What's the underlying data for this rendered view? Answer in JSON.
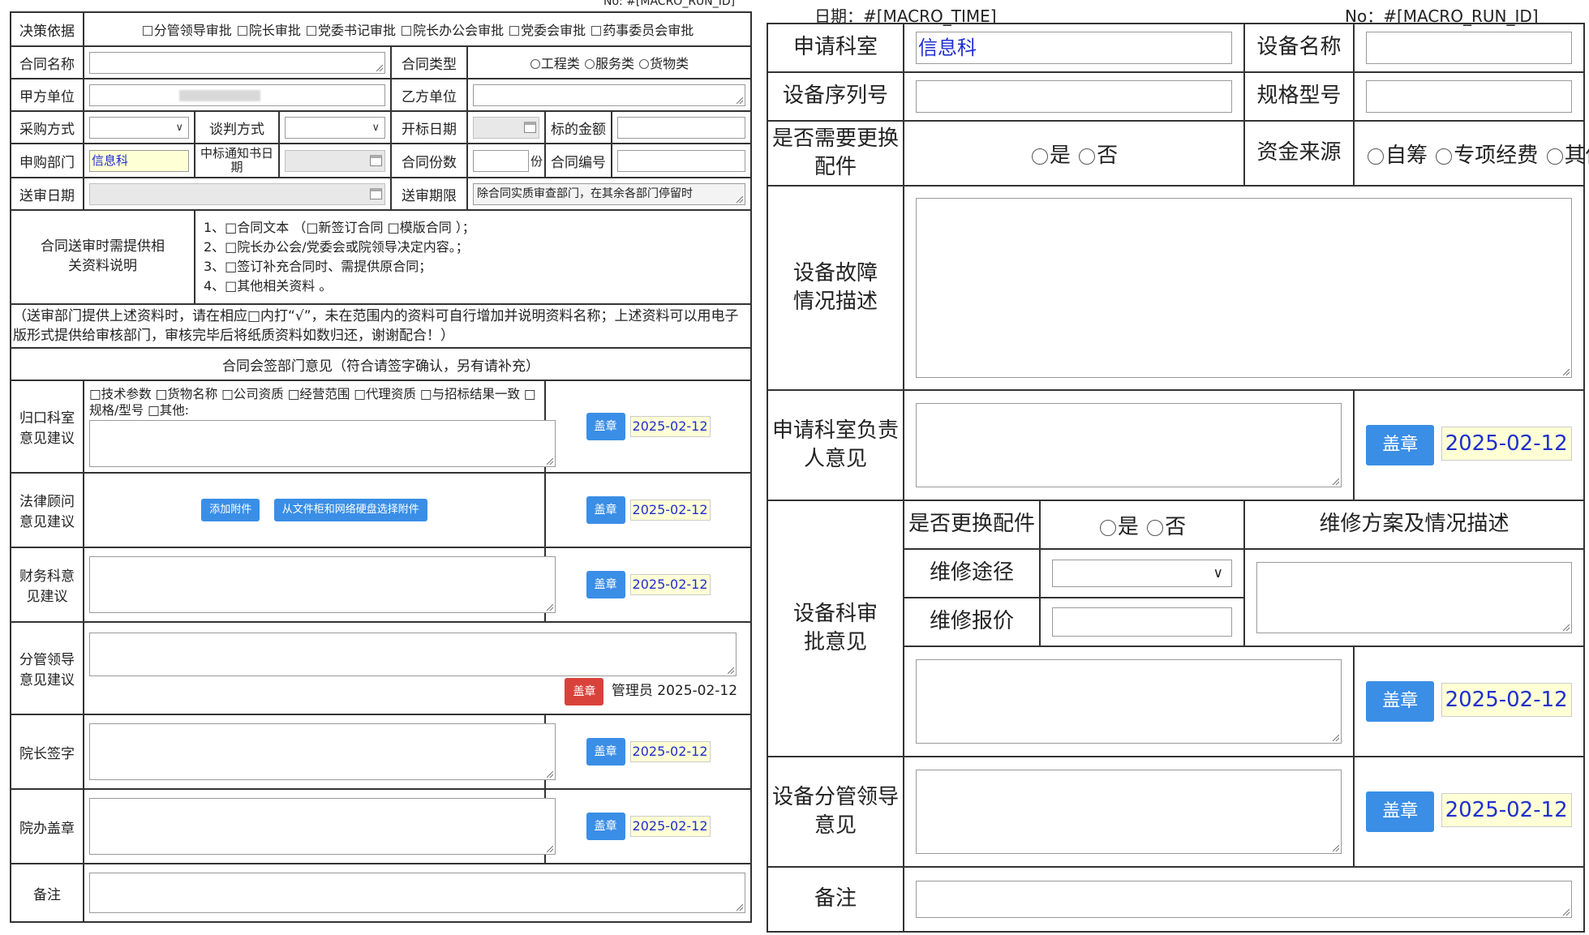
{
  "left": {
    "run_id": "No: #[MACRO_RUN_ID]",
    "decision_label": "决策依据",
    "decision_options": [
      "分管领导审批",
      "院长审批",
      "党委书记审批",
      "院长办公会审批",
      "党委会审批",
      "药事委员会审批"
    ],
    "contract_name_label": "合同名称",
    "contract_type_label": "合同类型",
    "contract_type_options": [
      "工程类",
      "服务类",
      "货物类"
    ],
    "party_a_label": "甲方单位",
    "party_b_label": "乙方单位",
    "purchase_method_label": "采购方式",
    "negotiation_method_label": "谈判方式",
    "bid_open_date_label": "开标日期",
    "bid_amount_label": "标的金额",
    "purchasing_dept_label": "申购部门",
    "purchasing_dept_value": "信息科",
    "award_notice_date_label": "中标通知书日期",
    "copies_label": "合同份数",
    "copies_unit": "份",
    "contract_no_label": "合同编号",
    "submit_date_label": "送审日期",
    "review_period_label": "送审期限",
    "review_period_value": "除合同实质审查部门，在其余各部门停留时",
    "materials_label": "合同送审时需提供相关资料说明",
    "materials_items": [
      "1、□合同文本 （□新签订合同 □模版合同 ）；",
      "2、□院长办公会/党委会或院领导决定内容。；",
      "3、□签订补充合同时、需提供原合同；",
      "4、□其他相关资料 。"
    ],
    "note_text": "（送审部门提供上述资料时，请在相应□内打“√”，未在范围内的资料可自行增加并说明资料名称；上述资料可以用电子版形式提供给审核部门，审核完毕后将纸质资料如数归还，谢谢配合！）",
    "countersign_title": "合同会签部门意见（符合请签字确认，另有请补充）",
    "dept_opinion_label": "归口科室意见建议",
    "dept_checks_text": "□技术参数 □货物名称 □公司资质 □经营范围 □代理资质 □与招标结果一致 □规格/型号 □其他:",
    "legal_label": "法律顾问意见建议",
    "add_attachment": "添加附件",
    "select_attachment": "从文件柜和网络硬盘选择附件",
    "finance_label": "财务科意见建议",
    "leader_label": "分管领导意见建议",
    "leader_signer": "管理员 2025-02-12",
    "president_label": "院长签字",
    "office_seal_label": "院办盖章",
    "remark_label": "备注",
    "seal_button": "盖章",
    "date_value": "2025-02-12"
  },
  "right": {
    "date_macro": "日期：#[MACRO_TIME]",
    "run_id": "No：#[MACRO_RUN_ID]",
    "apply_dept_label": "申请科室",
    "apply_dept_value": "信息科",
    "device_name_label": "设备名称",
    "serial_label": "设备序列号",
    "model_label": "规格型号",
    "need_parts_label": "是否需要更换配件",
    "yes": "是",
    "no": "否",
    "fund_source_label": "资金来源",
    "fund_options": [
      "自筹",
      "专项经费",
      "其他"
    ],
    "fault_label": "设备故障情况描述",
    "dept_head_label": "申请科室负责人意见",
    "equip_dept_label": "设备科审批意见",
    "replace_parts_label": "是否更换配件",
    "repair_plan_label": "维修方案及情况描述",
    "repair_route_label": "维修途径",
    "repair_quote_label": "维修报价",
    "leader_label": "设备分管领导意见",
    "remark_label": "备注",
    "seal_button": "盖章",
    "date_value": "2025-02-12"
  }
}
